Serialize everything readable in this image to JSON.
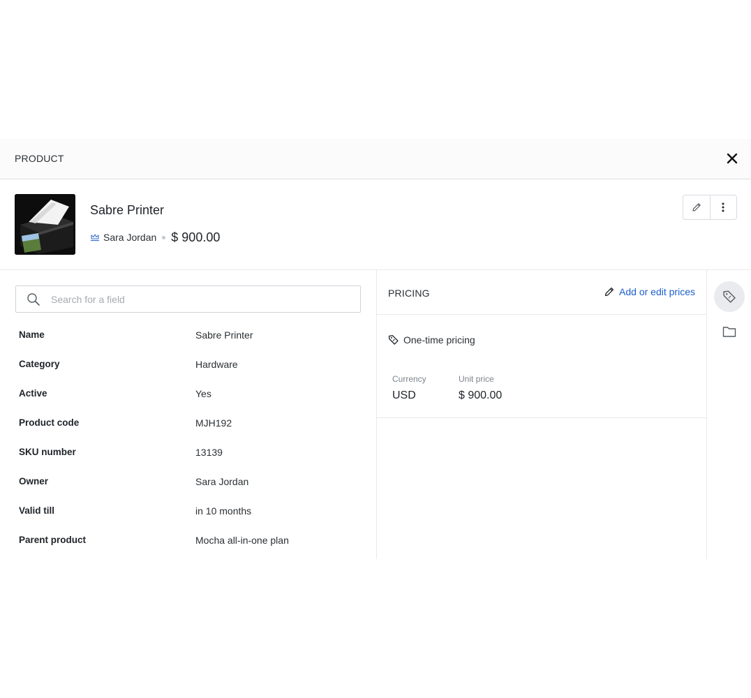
{
  "panel": {
    "title": "PRODUCT"
  },
  "entity": {
    "name": "Sabre Printer",
    "owner": "Sara Jordan",
    "price": "$ 900.00",
    "image_icon": "printer-image"
  },
  "toolbar": {
    "edit_icon": "pencil-icon",
    "more_icon": "more-vertical-icon"
  },
  "search": {
    "placeholder": "Search for a field",
    "value": ""
  },
  "fields": [
    {
      "label": "Name",
      "value": "Sabre Printer"
    },
    {
      "label": "Category",
      "value": "Hardware"
    },
    {
      "label": "Active",
      "value": "Yes"
    },
    {
      "label": "Product code",
      "value": "MJH192"
    },
    {
      "label": "SKU number",
      "value": "13139"
    },
    {
      "label": "Owner",
      "value": "Sara Jordan"
    },
    {
      "label": "Valid till",
      "value": "in 10 months"
    },
    {
      "label": "Parent product",
      "value": "Mocha all-in-one plan"
    }
  ],
  "pricing": {
    "title": "PRICING",
    "edit_label": "Add or edit prices",
    "type_label": "One-time pricing",
    "currency_caption": "Currency",
    "currency_value": "USD",
    "unit_price_caption": "Unit price",
    "unit_price_value": "$ 900.00"
  },
  "rail": {
    "items": [
      {
        "icon": "price-tag-icon",
        "active": true
      },
      {
        "icon": "folder-icon",
        "active": false
      }
    ]
  },
  "colors": {
    "link": "#1b5fcc",
    "border": "#e7e9ec",
    "header_bg": "#fbfbfb"
  }
}
